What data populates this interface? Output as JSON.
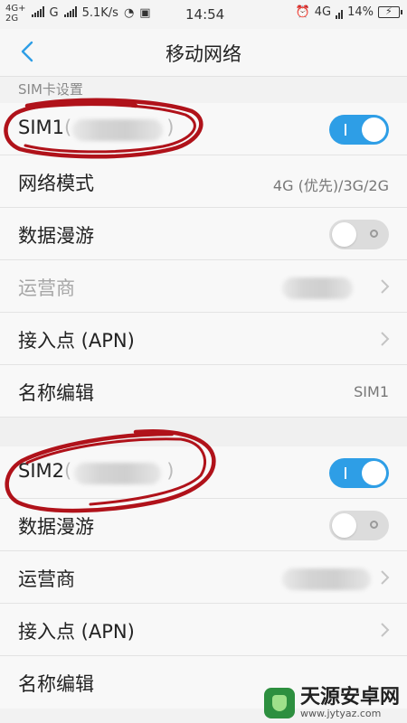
{
  "status": {
    "net1": "4G+",
    "net2": "2G",
    "net3": "G",
    "speed": "5.1K/s",
    "time": "14:54",
    "net_right": "4G",
    "battery": "14%"
  },
  "header": {
    "title": "移动网络"
  },
  "section_label": "SIM卡设置",
  "sim1": {
    "name": "SIM1",
    "paren_open": "(",
    "paren_close": ")",
    "network_mode_label": "网络模式",
    "network_mode_value": "4G (优先)/3G/2G",
    "roaming_label": "数据漫游",
    "carrier_label": "运营商",
    "apn_label": "接入点 (APN)",
    "name_edit_label": "名称编辑",
    "name_edit_value": "SIM1",
    "enabled": true,
    "roaming_enabled": false
  },
  "sim2": {
    "name": "SIM2",
    "paren_open": "(",
    "paren_close": ")",
    "roaming_label": "数据漫游",
    "carrier_label": "运营商",
    "apn_label": "接入点 (APN)",
    "name_edit_label": "名称编辑",
    "enabled": true,
    "roaming_enabled": false
  },
  "watermark": {
    "name": "天源安卓网",
    "url": "www.jytyaz.com"
  },
  "colors": {
    "toggle_on": "#2e9ee6",
    "annotation": "#b0121a"
  }
}
